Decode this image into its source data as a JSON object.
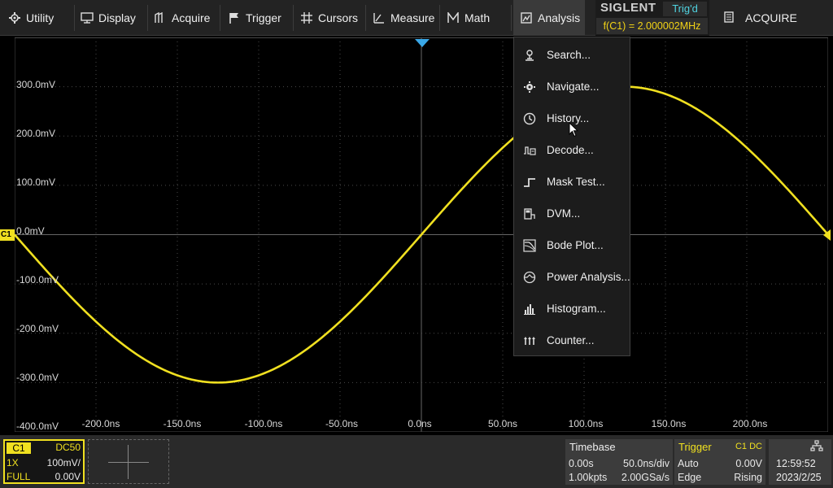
{
  "menu": {
    "items": [
      {
        "label": "Utility",
        "icon": "gear-icon"
      },
      {
        "label": "Display",
        "icon": "monitor-icon"
      },
      {
        "label": "Acquire",
        "icon": "acquire-icon"
      },
      {
        "label": "Trigger",
        "icon": "flag-icon"
      },
      {
        "label": "Cursors",
        "icon": "cursors-icon"
      },
      {
        "label": "Measure",
        "icon": "measure-icon"
      },
      {
        "label": "Math",
        "icon": "math-icon"
      },
      {
        "label": "Analysis",
        "icon": "analysis-icon"
      }
    ],
    "brand": "SIGLENT",
    "trig_status": "Trig'd",
    "frequency": "f(C1) = 2.000002MHz",
    "acquire_label": "ACQUIRE"
  },
  "analysis_menu": [
    {
      "label": "Search...",
      "icon": "search-probe-icon"
    },
    {
      "label": "Navigate...",
      "icon": "navigate-icon"
    },
    {
      "label": "History...",
      "icon": "clock-icon"
    },
    {
      "label": "Decode...",
      "icon": "decode-icon"
    },
    {
      "label": "Mask Test...",
      "icon": "mask-test-icon"
    },
    {
      "label": "DVM...",
      "icon": "dvm-icon"
    },
    {
      "label": "Bode Plot...",
      "icon": "bode-plot-icon"
    },
    {
      "label": "Power Analysis...",
      "icon": "power-analysis-icon"
    },
    {
      "label": "Histogram...",
      "icon": "histogram-icon"
    },
    {
      "label": "Counter...",
      "icon": "counter-icon"
    }
  ],
  "y_labels": [
    "300.0mV",
    "200.0mV",
    "100.0mV",
    "0.0mV",
    "-100.0mV",
    "-200.0mV",
    "-300.0mV",
    "-400.0mV"
  ],
  "x_labels": [
    "-200.0ns",
    "-150.0ns",
    "-100.0ns",
    "-50.0ns",
    "0.0ns",
    "50.0ns",
    "100.0ns",
    "150.0ns",
    "200.0ns"
  ],
  "channel": {
    "tag": "C1",
    "coupling": "DC50",
    "probe": "1X",
    "scale": "100mV/",
    "bandwidth": "FULL",
    "offset": "0.00V",
    "marker": "C1"
  },
  "timebase": {
    "title": "Timebase",
    "delay": "0.00s",
    "scale": "50.0ns/div",
    "memory": "1.00kpts",
    "sample_rate": "2.00GSa/s"
  },
  "trigger": {
    "title": "Trigger",
    "channel": "C1 DC",
    "mode": "Auto",
    "level": "0.00V",
    "type": "Edge",
    "slope": "Rising"
  },
  "clock": {
    "time": "12:59:52",
    "date": "2023/2/25",
    "icon": "network-icon"
  },
  "colors": {
    "trace": "#f0e020",
    "trigger_marker": "#3aa8e8",
    "grid": "#3a3a3a"
  },
  "chart_data": {
    "type": "line",
    "xlabel": "",
    "ylabel": "",
    "xlim": [
      -250,
      250
    ],
    "ylim": [
      -400,
      400
    ],
    "series": [
      {
        "frequency_mhz": 2.0,
        "amplitude_mv": 300,
        "phase": "rising zero-crossing at 0.0ns"
      }
    ]
  }
}
